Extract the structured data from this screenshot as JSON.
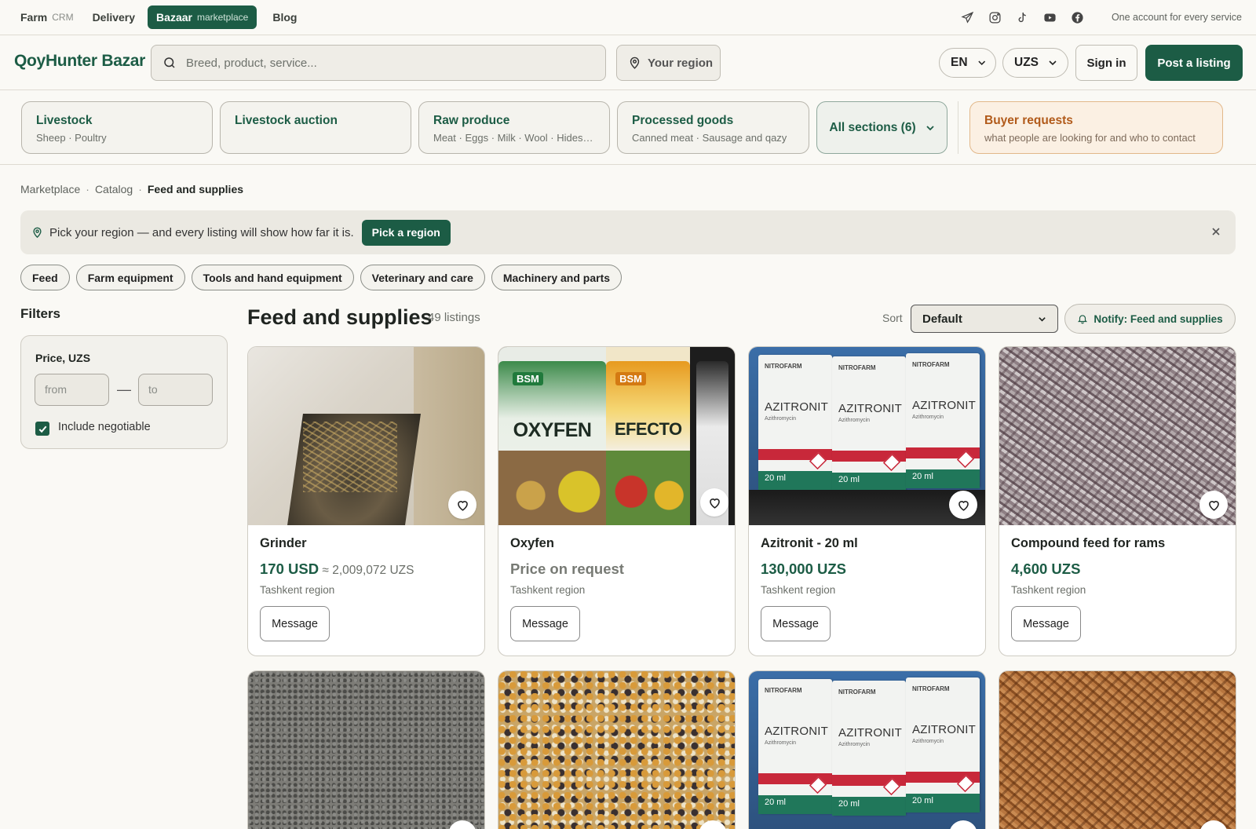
{
  "services": [
    {
      "name": "Farm",
      "sub": "CRM"
    },
    {
      "name": "Delivery",
      "sub": ""
    },
    {
      "name": "Bazaar",
      "sub": "marketplace"
    },
    {
      "name": "Blog",
      "sub": ""
    }
  ],
  "social_icons": [
    "telegram-icon",
    "instagram-icon",
    "tiktok-icon",
    "youtube-icon",
    "facebook-icon"
  ],
  "tagline": "One account for every service",
  "header": {
    "logo": "QoyHunter Bazar",
    "search_placeholder": "Breed, product, service...",
    "region_label": "Your region",
    "language": "EN",
    "currency": "UZS",
    "sign_in": "Sign in",
    "post_listing": "Post a listing"
  },
  "sections": [
    {
      "title": "Livestock",
      "desc": "Sheep · Poultry"
    },
    {
      "title": "Livestock auction",
      "desc": ""
    },
    {
      "title": "Raw produce",
      "desc": "Meat · Eggs · Milk · Wool · Hides · Honey"
    },
    {
      "title": "Processed goods",
      "desc": "Canned meat · Sausage and qazy"
    }
  ],
  "all_sections": "All sections (6)",
  "buyer_requests": {
    "title": "Buyer requests",
    "desc": "what people are looking for and who to contact"
  },
  "breadcrumb": [
    "Marketplace",
    "Catalog",
    "Feed and supplies"
  ],
  "notice": {
    "text": "Pick your region — and every listing will show how far it is.",
    "button": "Pick a region"
  },
  "chips": [
    "Feed",
    "Farm equipment",
    "Tools and hand equipment",
    "Veterinary and care",
    "Machinery and parts"
  ],
  "filters": {
    "title": "Filters",
    "price_label": "Price, UZS",
    "from_placeholder": "from",
    "to_placeholder": "to",
    "dash": "—",
    "include_negotiable": "Include negotiable",
    "include_negotiable_checked": true
  },
  "results": {
    "title": "Feed and supplies",
    "count": "49 listings",
    "sort_label": "Sort",
    "sort_value": "Default",
    "notify": "Notify: Feed and supplies"
  },
  "listings": [
    {
      "title": "Grinder",
      "price": "170 USD",
      "converted": " ≈ 2,009,072 UZS",
      "region": "Tashkent region",
      "button": "Message"
    },
    {
      "title": "Oxyfen",
      "price": "Price on request",
      "converted": "",
      "region": "Tashkent region",
      "button": "Message"
    },
    {
      "title": "Azitronit - 20 ml",
      "price": "130,000 UZS",
      "converted": "",
      "region": "Tashkent region",
      "button": "Message"
    },
    {
      "title": "Compound feed for rams",
      "price": "4,600 UZS",
      "converted": "",
      "region": "Tashkent region",
      "button": "Message"
    }
  ],
  "product_texts": {
    "bsm": "BSM",
    "oxyfen": "OXYFEN",
    "efecto": "EFECTO",
    "azitronit": "AZITRONIT",
    "azitromycin": "Azithromycin",
    "nitrofarm": "NITROFARM",
    "ml20": "20 ml"
  },
  "colors": {
    "brand": "#1c5c45",
    "accent_orange": "#b15a1a",
    "background": "#faf9f5"
  }
}
